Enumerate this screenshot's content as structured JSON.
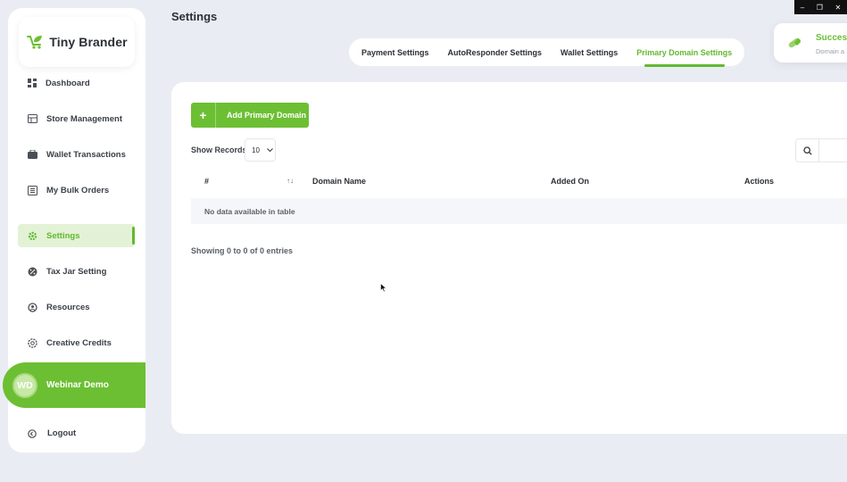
{
  "window": {
    "minimize": "–",
    "maximize": "❐",
    "close": "✕"
  },
  "brand": {
    "name": "Tiny Brander",
    "accent": "#6cbf33"
  },
  "sidebar": {
    "items": [
      {
        "label": "Dashboard",
        "icon": "dashboard-icon"
      },
      {
        "label": "Store Management",
        "icon": "store-icon"
      },
      {
        "label": "Wallet Transactions",
        "icon": "wallet-icon"
      },
      {
        "label": "My Bulk Orders",
        "icon": "orders-icon"
      },
      {
        "label": "Settings",
        "icon": "gear-icon",
        "active": true
      },
      {
        "label": "Tax Jar Setting",
        "icon": "percent-icon"
      },
      {
        "label": "Resources",
        "icon": "resources-icon"
      },
      {
        "label": "Creative Credits",
        "icon": "credits-icon"
      }
    ],
    "user": {
      "initials": "WD",
      "name": "Webinar Demo"
    },
    "logout_label": "Logout"
  },
  "page": {
    "title": "Settings"
  },
  "tabs": [
    {
      "label": "Payment Settings"
    },
    {
      "label": "AutoResponder Settings"
    },
    {
      "label": "Wallet Settings"
    },
    {
      "label": "Primary Domain Settings",
      "active": true
    }
  ],
  "toast": {
    "title": "Succes",
    "message": "Domain a"
  },
  "content": {
    "add_button_label": "Add Primary Domain",
    "show_records_label": "Show Records",
    "records_value": "10",
    "table": {
      "headers": [
        "#",
        "Domain Name",
        "Added On",
        "Actions"
      ],
      "empty_message": "No data available in table"
    },
    "entries_text": "Showing 0 to 0 of 0 entries"
  }
}
